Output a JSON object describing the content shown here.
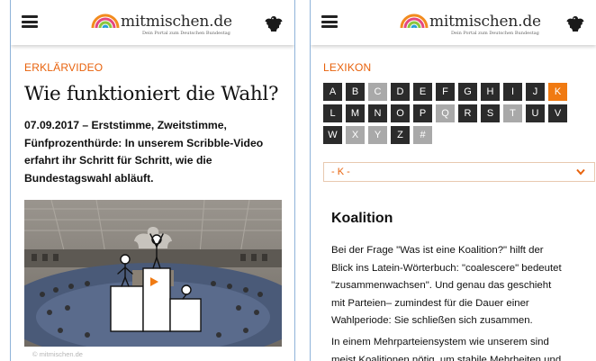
{
  "left": {
    "logo_text": "mitmischen.de",
    "logo_sub": "Dein Portal zum Deutschen Bundestag",
    "kicker": "ERKLÄRVIDEO",
    "headline": "Wie funktioniert die Wahl?",
    "teaser_lines": [
      "07.09.2017 – Erststimme, Zweitstimme,",
      "Fünfprozenthürde: In unserem Scribble-Video",
      "erfahrt ihr Schritt für Schritt, wie die",
      "Bundestagswahl abläuft."
    ],
    "copyright": "© mitmischen.de"
  },
  "right": {
    "logo_text": "mitmischen.de",
    "logo_sub": "Dein Portal zum Deutschen Bundestag",
    "kicker": "LEXIKON",
    "alphabet": [
      {
        "label": "A",
        "state": "dark"
      },
      {
        "label": "B",
        "state": "dark"
      },
      {
        "label": "C",
        "state": "light"
      },
      {
        "label": "D",
        "state": "dark"
      },
      {
        "label": "E",
        "state": "dark"
      },
      {
        "label": "F",
        "state": "dark"
      },
      {
        "label": "G",
        "state": "dark"
      },
      {
        "label": "H",
        "state": "dark"
      },
      {
        "label": "I",
        "state": "dark"
      },
      {
        "label": "J",
        "state": "dark"
      },
      {
        "label": "K",
        "state": "active"
      },
      {
        "label": "L",
        "state": "dark"
      },
      {
        "label": "M",
        "state": "dark"
      },
      {
        "label": "N",
        "state": "dark"
      },
      {
        "label": "O",
        "state": "dark"
      },
      {
        "label": "P",
        "state": "dark"
      },
      {
        "label": "Q",
        "state": "light"
      },
      {
        "label": "R",
        "state": "dark"
      },
      {
        "label": "S",
        "state": "dark"
      },
      {
        "label": "T",
        "state": "light"
      },
      {
        "label": "U",
        "state": "dark"
      },
      {
        "label": "V",
        "state": "dark"
      },
      {
        "label": "W",
        "state": "dark"
      },
      {
        "label": "X",
        "state": "light"
      },
      {
        "label": "Y",
        "state": "light"
      },
      {
        "label": "Z",
        "state": "dark"
      },
      {
        "label": "#",
        "state": "light"
      }
    ],
    "select_value": "- K -",
    "title": "Koalition",
    "p1_lines": [
      "Bei der Frage \"Was ist eine Koalition?\" hilft der",
      "Blick ins Latein-Wörterbuch: \"coalescere\" bedeutet",
      "\"zusammenwachsen\". Und genau das geschieht",
      "mit Parteien– zumindest für die Dauer einer",
      "Wahlperiode: Sie schließen sich zusammen."
    ],
    "p2_lines": [
      "In einem Mehrparteiensystem wie unserem sind",
      "meist Koalitionen nötig, um stabile Mehrheiten und"
    ]
  },
  "colors": {
    "accent": "#e8620c",
    "alpha_dark": "#2b2b2b",
    "alpha_light": "#a9a9a9",
    "alpha_active": "#f07a12",
    "divider": "#8fb3d9"
  }
}
